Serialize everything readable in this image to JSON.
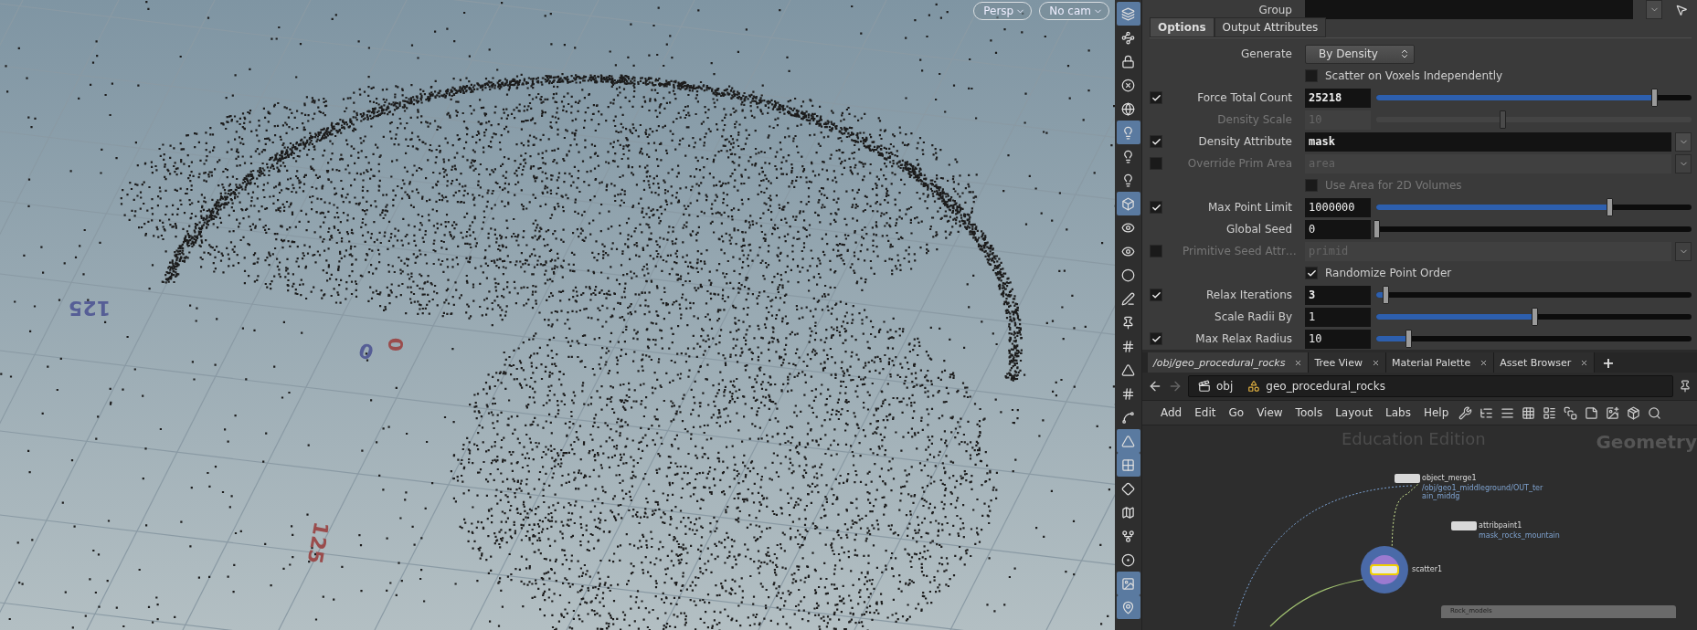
{
  "viewport": {
    "buttons": [
      {
        "label": "Persp"
      },
      {
        "label": "No cam"
      }
    ],
    "grid_labels": [
      {
        "text": "125",
        "color": "#565e96"
      },
      {
        "text": "0",
        "color": "#565e96"
      },
      {
        "text": "0",
        "color": "#9a4c4c"
      },
      {
        "text": "125",
        "color": "#9a4c4c"
      }
    ]
  },
  "toolbar": [
    {
      "on": true
    },
    {
      "on": false
    },
    {
      "on": false
    },
    {
      "on": false
    },
    {
      "on": false
    },
    {
      "on": true
    },
    {
      "on": false
    },
    {
      "on": false
    },
    {
      "on": true
    },
    {
      "on": false
    },
    {
      "on": false
    },
    {
      "on": false
    },
    {
      "on": false
    },
    {
      "on": false
    },
    {
      "on": false
    },
    {
      "on": false
    },
    {
      "on": false
    },
    {
      "on": false
    },
    {
      "on": true
    },
    {
      "on": true
    },
    {
      "on": false
    },
    {
      "on": false
    },
    {
      "on": false
    },
    {
      "on": false
    },
    {
      "on": true
    },
    {
      "on": true
    }
  ],
  "parameters": {
    "group": {
      "label": "Group"
    },
    "tabs": [
      {
        "label": "Options",
        "selected": true
      },
      {
        "label": "Output Attributes",
        "selected": false
      }
    ],
    "rows": [
      {
        "kind": "menu",
        "label": "Generate",
        "value": "By Density",
        "disabled": false
      },
      {
        "kind": "checkbox",
        "label": "Scatter on Voxels Independently",
        "checked": false,
        "disabled": false
      },
      {
        "kind": "int",
        "label": "Force Total Count",
        "toggle": true,
        "value": "25218",
        "changed": true,
        "level": 0.88,
        "disabled": false
      },
      {
        "kind": "int",
        "label": "Density Scale",
        "value": "10",
        "changed": false,
        "level": 0.4,
        "disabled": true
      },
      {
        "kind": "string",
        "label": "Density Attribute",
        "toggle": true,
        "value": "mask",
        "changed": true,
        "disabled": false
      },
      {
        "kind": "string",
        "label": "Override Prim Area",
        "toggle": false,
        "value": "area",
        "changed": false,
        "disabled": true
      },
      {
        "kind": "checkbox",
        "label": "Use Area for 2D Volumes",
        "checked": false,
        "disabled": true
      },
      {
        "kind": "int",
        "label": "Max Point Limit",
        "toggle": true,
        "value": "1000000",
        "changed": false,
        "level": 0.74,
        "disabled": false
      },
      {
        "kind": "int",
        "label": "Global Seed",
        "value": "0",
        "changed": false,
        "level": 0,
        "disabled": false
      },
      {
        "kind": "string",
        "label": "Primitive Seed Attr…",
        "toggle": false,
        "value": "primid",
        "changed": false,
        "disabled": true
      },
      {
        "kind": "checkbox",
        "label": "Randomize Point Order",
        "checked": true,
        "disabled": false
      },
      {
        "kind": "int",
        "label": "Relax Iterations",
        "toggle": true,
        "value": "3",
        "changed": true,
        "level": 0.03,
        "disabled": false
      },
      {
        "kind": "int",
        "label": "Scale Radii By",
        "value": "1",
        "changed": false,
        "level": 0.5,
        "disabled": false
      },
      {
        "kind": "int",
        "label": "Max Relax Radius",
        "toggle": true,
        "value": "10",
        "changed": false,
        "level": 0.1,
        "disabled": false
      }
    ]
  },
  "network": {
    "tabs": [
      {
        "label": "/obj/geo_procedural_rocks",
        "selected": true
      },
      {
        "label": "Tree View",
        "selected": false
      },
      {
        "label": "Material Palette",
        "selected": false
      },
      {
        "label": "Asset Browser",
        "selected": false
      }
    ],
    "add_tab": "+",
    "path": [
      "obj",
      "geo_procedural_rocks"
    ],
    "menu": [
      "Add",
      "Edit",
      "Go",
      "View",
      "Tools",
      "Layout",
      "Labs",
      "Help"
    ],
    "watermark": "Education Edition",
    "context": "Geometry",
    "nodes": [
      {
        "name": "object_merge1",
        "detail": "/obj/geo1_middleground/OUT_ter ain_middg",
        "selected": false
      },
      {
        "name": "attribpaint1",
        "detail": "mask_rocks_mountain",
        "selected": false
      },
      {
        "name": "scatter1",
        "selected": true
      }
    ],
    "network_box": "Rock_models"
  }
}
